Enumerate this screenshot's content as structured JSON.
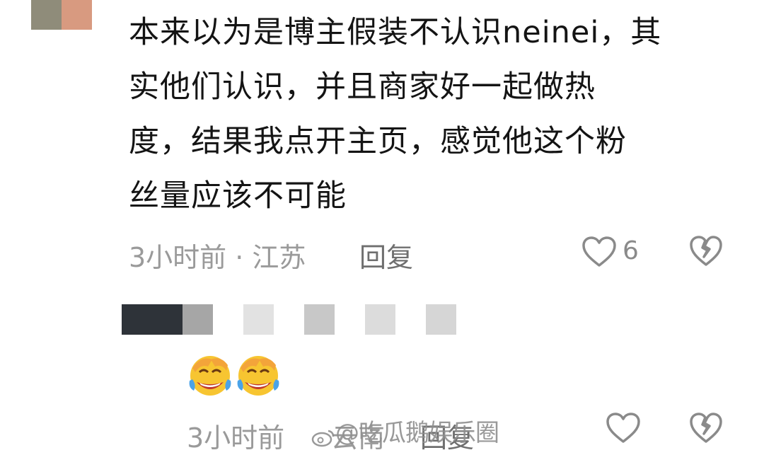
{
  "comment": {
    "text_lines": [
      "本来以为是博主假装不认识neinei，其",
      "实他们认识，并且商家好一起做热",
      "度，结果我点开主页，感觉他这个粉",
      "丝量应该不可能"
    ],
    "meta": "3小时前 · 江苏",
    "reply_label": "回复",
    "like_count": "6"
  },
  "reply": {
    "meta": "3小时前",
    "meta_location": "云南",
    "reply_label": "回复",
    "emojis": [
      "laughing-crying-emoji",
      "laughing-crying-emoji"
    ]
  },
  "watermark": "@吃瓜鹅娱乐圈",
  "colors": {
    "avatar_left": "#8f8c7a",
    "avatar_right": "#d89a80",
    "name_dark": "#2e3339",
    "name_mid": "#a6a6a6",
    "name_light": "#e2e2e2",
    "icon_gray": "#9a9a9a"
  }
}
